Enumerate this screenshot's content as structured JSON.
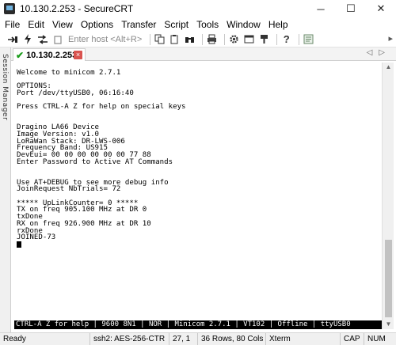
{
  "window": {
    "title": "10.130.2.253 - SecureCRT",
    "minimize_glyph": "─",
    "maximize_glyph": "☐",
    "close_glyph": "✕"
  },
  "menu": [
    "File",
    "Edit",
    "View",
    "Options",
    "Transfer",
    "Script",
    "Tools",
    "Window",
    "Help"
  ],
  "toolbar": {
    "host_placeholder": "Enter host <Alt+R>",
    "icons": [
      "connect-icon",
      "quick-connect-icon",
      "tabs-icon",
      "disconnect-icon",
      "copy-icon",
      "paste-icon",
      "find-icon",
      "print-icon",
      "settings-icon",
      "options-icon",
      "keymap-icon",
      "help-icon",
      "sftp-icon"
    ]
  },
  "sidebar": {
    "label": "Session Manager"
  },
  "tab": {
    "label": "10.130.2.253",
    "close_glyph": "×",
    "arrows": "◁▷"
  },
  "terminal": {
    "lines": [
      "",
      "Welcome to minicom 2.7.1",
      "",
      "OPTIONS:",
      "Port /dev/ttyUSB0, 06:16:40",
      "",
      "Press CTRL-A Z for help on special keys",
      "",
      "",
      "Dragino LA66 Device",
      "Image Version: v1.0",
      "LoRaWan Stack: DR-LWS-006",
      "Frequency Band: US915",
      "DevEui= 00 00 00 00 00 00 77 88",
      "Enter Password to Active AT Commands",
      "",
      "",
      "Use AT+DEBUG to see more debug info",
      "JoinRequest NbTrials= 72",
      "",
      "***** UpLinkCounter= 0 *****",
      "TX on freq 905.100 MHz at DR 0",
      "txDone",
      "RX on freq 926.900 MHz at DR 10",
      "rxDone",
      "JOINED-73"
    ],
    "status_line": "CTRL-A Z for help | 9600 8N1 | NOR | Minicom 2.7.1 | VT102 | Offline | ttyUSB0"
  },
  "statusbar": {
    "ready": "Ready",
    "cipher": "ssh2: AES-256-CTR",
    "cursor_pos": "27,  1",
    "size": "36 Rows, 80 Cols",
    "emulation": "Xterm",
    "caps": "CAP",
    "num": "NUM"
  }
}
